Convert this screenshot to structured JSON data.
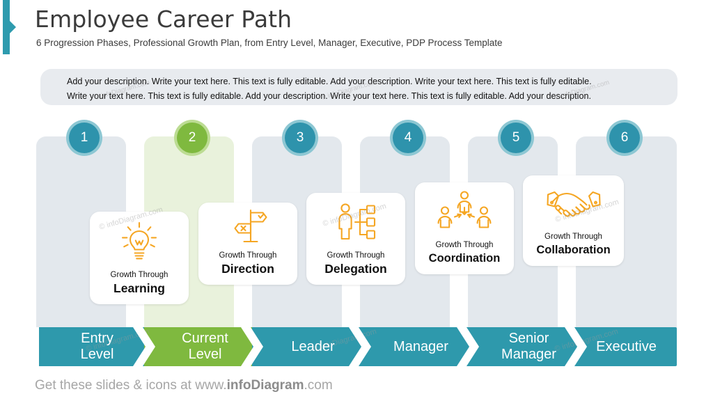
{
  "header": {
    "title": "Employee Career Path",
    "subtitle": "6 Progression Phases, Professional Growth Plan, from Entry Level, Manager, Executive, PDP Process Template",
    "accent_color": "#2E9BAE"
  },
  "description": {
    "line1": "Add your description. Write your text here. This text is fully editable. Add your description. Write your text here. This text is fully editable.",
    "line2": "Write your text here. This text is fully editable. Add your description. Write your text here. This text is fully editable. Add your description.",
    "background_color": "#E8EBEF"
  },
  "phases": [
    {
      "number": "1",
      "stage_label": "Entry\nLevel",
      "stage_line1": "Entry",
      "stage_line2": "Level",
      "card_sub": "Growth Through",
      "card_title": "Learning",
      "icon": "lightbulb-icon",
      "color": "#2E93AC",
      "ring_color": "#8DC7D3",
      "column_color": "#E3E8ED",
      "highlight": false
    },
    {
      "number": "2",
      "stage_line1": "Current",
      "stage_line2": "Level",
      "card_sub": "Growth Through",
      "card_title": "Direction",
      "icon": "signpost-icon",
      "color": "#7FB93F",
      "ring_color": "#BCDC93",
      "column_color": "#E9F2DC",
      "highlight": true
    },
    {
      "number": "3",
      "stage_line1": "Leader",
      "stage_line2": "",
      "card_sub": "Growth Through",
      "card_title": "Delegation",
      "icon": "delegation-icon",
      "color": "#2E93AC",
      "ring_color": "#8DC7D3",
      "column_color": "#E3E8ED",
      "highlight": false
    },
    {
      "number": "4",
      "stage_line1": "Manager",
      "stage_line2": "",
      "card_sub": "Growth Through",
      "card_title": "Coordination",
      "icon": "coordination-icon",
      "color": "#2E93AC",
      "ring_color": "#8DC7D3",
      "column_color": "#E3E8ED",
      "highlight": false
    },
    {
      "number": "5",
      "stage_line1": "Senior",
      "stage_line2": "Manager",
      "card_sub": "Growth Through",
      "card_title": "Collaboration",
      "icon": "handshake-icon",
      "color": "#2E93AC",
      "ring_color": "#8DC7D3",
      "column_color": "#E3E8ED",
      "highlight": false
    },
    {
      "number": "6",
      "stage_line1": "Executive",
      "stage_line2": "",
      "card_sub": "",
      "card_title": "",
      "icon": "",
      "color": "#2E93AC",
      "ring_color": "#8DC7D3",
      "column_color": "#E3E8ED",
      "highlight": false
    }
  ],
  "footer": {
    "prefix": "Get these slides & icons at www.",
    "brand": "infoDiagram",
    "suffix": ".com"
  },
  "watermark": {
    "text": "© infoDiagram.com"
  },
  "theme": {
    "teal": "#2E99AC",
    "green": "#7FB93F",
    "icon_orange": "#F5A623",
    "card_bg": "#FFFFFF",
    "slide_bg": "#FFFFFF"
  }
}
